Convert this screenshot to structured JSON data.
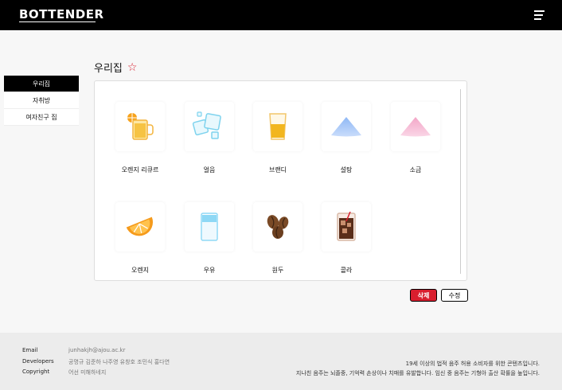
{
  "header": {
    "logo": "BOTTENDER"
  },
  "sidebar": {
    "items": [
      {
        "label": "우리집",
        "active": true
      },
      {
        "label": "자취방",
        "active": false
      },
      {
        "label": "여자친구 집",
        "active": false
      }
    ]
  },
  "page": {
    "title": "우리집",
    "favorite_icon": "star-outline-icon"
  },
  "ingredients": [
    {
      "label": "오렌지 리큐르",
      "icon": "orange-liqueur-glass-icon"
    },
    {
      "label": "얼음",
      "icon": "ice-cubes-icon"
    },
    {
      "label": "브랜디",
      "icon": "brandy-glass-icon"
    },
    {
      "label": "설탕",
      "icon": "sugar-pile-icon"
    },
    {
      "label": "소금",
      "icon": "salt-pile-icon"
    },
    {
      "label": "오렌지",
      "icon": "orange-slice-icon"
    },
    {
      "label": "우유",
      "icon": "milk-glass-icon"
    },
    {
      "label": "원두",
      "icon": "coffee-beans-icon"
    },
    {
      "label": "콜라",
      "icon": "cola-glass-icon"
    }
  ],
  "actions": {
    "delete_label": "삭제",
    "edit_label": "수정"
  },
  "footer": {
    "email_label": "Email",
    "email_value": "junhakjh@ajou.ac.kr",
    "developers_label": "Developers",
    "developers_value": "공명규 김준하 나주영 유창호 조민식 홍다연",
    "copyright_label": "Copyright",
    "copyright_value": "어선 미해하네지",
    "notice_1": "19세 이상의 법적 음주 허용 소비자를 위한 콘텐츠입니다.",
    "notice_2": "지나친 음주는 뇌졸중, 기억력 손상이나 치매를 유발합니다. 임신 중 음주는 기형아 출산 확률을 높입니다."
  },
  "colors": {
    "accent": "#d81e2e",
    "header_bg": "#000000",
    "footer_bg": "#ececec"
  }
}
